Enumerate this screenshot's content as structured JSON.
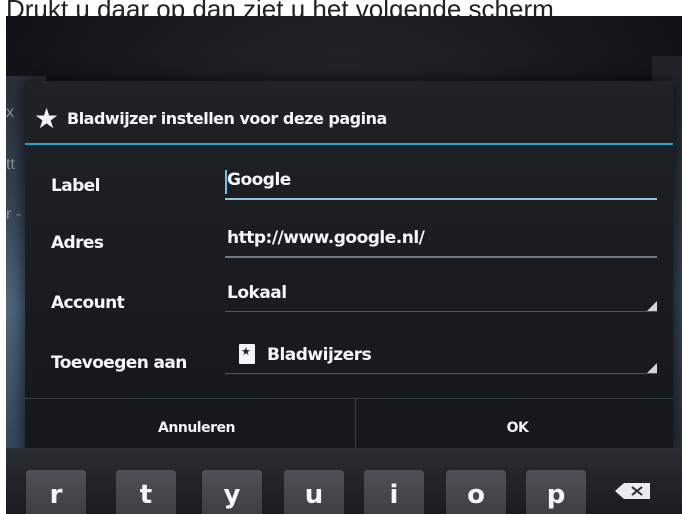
{
  "caption": "Drukt u daar op dan ziet u het volgende scherm",
  "dialog": {
    "title": "Bladwijzer instellen voor deze pagina",
    "rows": [
      {
        "label": "Label",
        "value": "Google"
      },
      {
        "label": "Adres",
        "value": "http://www.google.nl/"
      },
      {
        "label": "Account",
        "value": "Lokaal"
      },
      {
        "label": "Toevoegen aan",
        "value": "Bladwijzers"
      }
    ],
    "cancel_label": "Annuleren",
    "ok_label": "OK"
  },
  "keyboard": {
    "keys": [
      "r",
      "t",
      "y",
      "u",
      "i",
      "o",
      "p"
    ]
  },
  "background": {
    "side_chars": [
      "x",
      "tt",
      "r -"
    ]
  },
  "colors": {
    "accent": "#2f9fd0",
    "dialog_bg": "#1f2226",
    "text": "#f5f7fa"
  }
}
